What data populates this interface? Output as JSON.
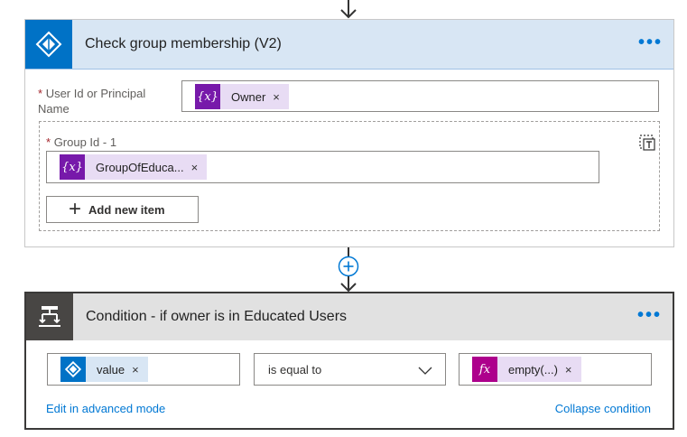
{
  "action1": {
    "title": "Check group membership (V2)",
    "more": "•••",
    "user_field": {
      "required_mark": "*",
      "label": "User Id or Principal Name",
      "token": "Owner",
      "remove": "×"
    },
    "group_field": {
      "required_mark": "*",
      "label": "Group Id - 1",
      "token": "GroupOfEduca...",
      "remove": "×"
    },
    "add_item_label": "Add new item",
    "add_item_icon": "+"
  },
  "action2": {
    "title": "Condition - if owner is in Educated Users",
    "more": "•••",
    "left_operand": {
      "token": "value",
      "remove": "×"
    },
    "operator": "is equal to",
    "right_operand": {
      "token": "empty(...)",
      "icon": "fx",
      "remove": "×"
    },
    "edit_advanced": "Edit in advanced mode",
    "collapse": "Collapse condition"
  },
  "variable_icon": "{x}",
  "colors": {
    "accent": "#0078d4",
    "variable": "#7719aa",
    "expression": "#ad008c",
    "condition_icon": "#484644"
  }
}
